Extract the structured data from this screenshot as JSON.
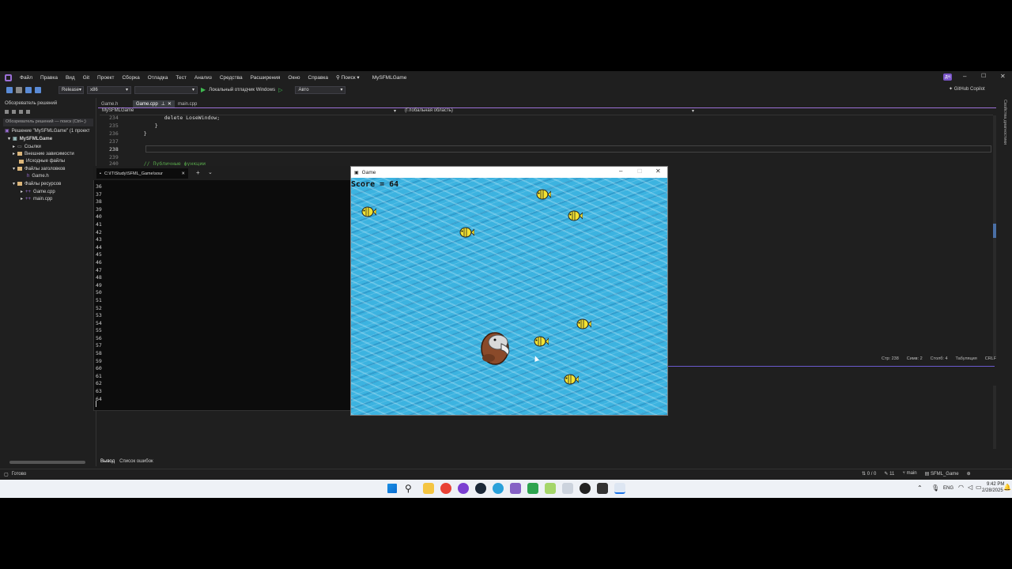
{
  "ide": {
    "menus": [
      "Файл",
      "Правка",
      "Вид",
      "Git",
      "Проект",
      "Сборка",
      "Отладка",
      "Тест",
      "Анализ",
      "Средства",
      "Расширения",
      "Окно",
      "Справка"
    ],
    "search_label": "Поиск",
    "solution_name": "MySFMLGame",
    "avatar_initials": "ДН",
    "config": "Release",
    "platform": "x86",
    "debug_target": "Локальный отладчик Windows",
    "auto": "Авто",
    "copilot": "GitHub Copilot",
    "side_label": "Свойства диагностики"
  },
  "solution_explorer": {
    "title": "Обозреватель решений",
    "search_placeholder": "Обозреватель решений — поиск (Ctrl+;)",
    "items": [
      {
        "label": "Решение \"MySFMLGame\" (1 проект"
      },
      {
        "label": "MySFMLGame"
      },
      {
        "label": "Ссылки"
      },
      {
        "label": "Внешние зависимости"
      },
      {
        "label": "Исходные файлы"
      },
      {
        "label": "Файлы заголовков"
      },
      {
        "label": "Game.h"
      },
      {
        "label": "Файлы ресурсов"
      },
      {
        "label": "Game.cpp"
      },
      {
        "label": "main.cpp"
      }
    ]
  },
  "editor": {
    "tabs": [
      "Game.h",
      "Game.cpp",
      "main.cpp"
    ],
    "scope_project": "MySFMLGame",
    "scope_global": "(Глобальная область)",
    "lines": [
      {
        "num": "234",
        "code": "delete LoseWindow;"
      },
      {
        "num": "235",
        "code": "}"
      },
      {
        "num": "236",
        "code": "}"
      },
      {
        "num": "237",
        "code": ""
      },
      {
        "num": "238",
        "code": ""
      },
      {
        "num": "239",
        "code": ""
      },
      {
        "num": "240",
        "code": "// Публичные функции"
      }
    ],
    "status": {
      "line": "Стр: 238",
      "char": "Симв: 2",
      "col": "Столб: 4",
      "tabs": "Табуляция",
      "eol": "CRLF"
    }
  },
  "output_panel": {
    "tab_output": "Вывод",
    "tab_errors": "Список ошибок"
  },
  "terminal": {
    "title": "C:\\IT\\Study\\SFML_Game\\sour",
    "lines": [
      "36",
      "37",
      "38",
      "39",
      "40",
      "41",
      "42",
      "43",
      "44",
      "45",
      "46",
      "47",
      "48",
      "49",
      "50",
      "51",
      "52",
      "53",
      "54",
      "55",
      "56",
      "57",
      "58",
      "59",
      "60",
      "61",
      "62",
      "63",
      "64"
    ]
  },
  "game": {
    "window_title": "Game",
    "score_text": "Score = 64"
  },
  "status_bar": {
    "ready": "Готово",
    "arrows": "0 / 0",
    "pencil": "11",
    "branch": "main",
    "repo": "SFML_Game"
  },
  "taskbar": {
    "lang": "ENG",
    "time": "9:42 PM",
    "date": "2/28/2025"
  },
  "colors": {
    "accent": "#5a8bd6",
    "run_green": "#3fb950",
    "fish_yellow": "#f2e232",
    "sea": "#3cb3e0"
  }
}
